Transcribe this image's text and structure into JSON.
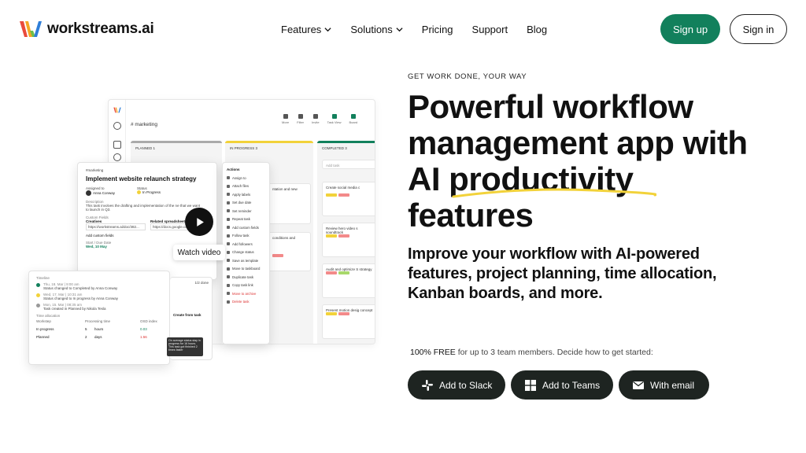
{
  "brand": {
    "name": "workstreams.ai"
  },
  "nav": {
    "items": [
      {
        "label": "Features",
        "dropdown": true
      },
      {
        "label": "Solutions",
        "dropdown": true
      },
      {
        "label": "Pricing",
        "dropdown": false
      },
      {
        "label": "Support",
        "dropdown": false
      },
      {
        "label": "Blog",
        "dropdown": false
      }
    ],
    "signup": "Sign up",
    "signin": "Sign in"
  },
  "hero": {
    "kicker": "GET WORK DONE, YOUR WAY",
    "title_lines": [
      "Powerful workflow",
      "management app with",
      "AI productivity",
      "features"
    ],
    "subtitle_lines": [
      "Improve your workflow with AI-powered",
      "features, project planning, time allocation,",
      "Kanban boards, and more."
    ],
    "free_bold": "100% FREE",
    "free_rest": " for up to 3 team members.  Decide how to get started:",
    "cta_slack": "Add to Slack",
    "cta_teams": "Add to Teams",
    "cta_email": "With email"
  },
  "mockup": {
    "channel": "# marketing",
    "toolbar": [
      "More",
      "Filter",
      "Invite",
      "Task View",
      "Board"
    ],
    "columns": [
      {
        "title": "PLANNED",
        "count": "1"
      },
      {
        "title": "IN PROGRESS",
        "count": "3"
      },
      {
        "title": "COMPLETED",
        "count": "3"
      }
    ],
    "add_task": "Add task",
    "completed_cards": [
      "Create social media c",
      "Review hero video s soundtrack",
      "Audit and optimize S strategy",
      "Present motion desig concept"
    ],
    "inprogress_cards": [
      "ntation and new",
      "conditions and"
    ],
    "task_panel": {
      "channel": "#marketing",
      "title": "Implement website relaunch strategy",
      "assigned_label": "Assigned to",
      "assigned_value": "Anna Conway",
      "status_label": "Status",
      "status_value": "In Progress",
      "description_label": "Description",
      "description": "This task involves the drafting and implementation of the ne that we want to launch in Q3.",
      "custom_fields_label": "Custom Fields",
      "creatives_label": "Creatives",
      "creatives_value": "https://workstreams.ai/doc/382...",
      "spreadsheet_label": "Related spreadsheet",
      "spreadsheet_value": "https://docs.google.com/spread...",
      "add_custom": "Add custom fields",
      "dates_label": "Start / Due Date",
      "dates_value": "Wed, 10 May"
    },
    "actions_panel": {
      "title": "Actions",
      "items": [
        "Assign to",
        "Attach files",
        "Apply labels",
        "Set due date",
        "Set reminder",
        "Repeat task",
        "Add custom fields",
        "Follow task",
        "Add followers",
        "Change status",
        "Save as template",
        "Move to taskboard",
        "Duplicate task",
        "Copy task link",
        "Move to archive",
        "Delete task"
      ]
    },
    "timeline_panel": {
      "title": "Timeline",
      "progress": "1/2 done",
      "entries": [
        {
          "date": "Thu, 18. Mar | 9:00 am",
          "text": "Status changed to Completed by Anna Conway"
        },
        {
          "date": "Wed, 17. Mar | 10:31 am",
          "text": "Status changed to In progress by Anna Conway"
        },
        {
          "date": "Mon, 15. Mar | 08:35 am",
          "text": "Task created in Planned by Nikola Tesla"
        }
      ],
      "time_alloc_label": "Time allocation",
      "headers": [
        "Workstep",
        "Processing time",
        "OSD index"
      ],
      "rows": [
        {
          "step": "In progress",
          "time": "5",
          "unit": "hours",
          "index": "0.03"
        },
        {
          "step": "Planned",
          "time": "2",
          "unit": "days",
          "index": "1.56"
        }
      ],
      "create_from_task": "Create from task",
      "tooltip": "On average status stay in progress for 16 hours. This task got finished 2 times faster"
    },
    "watch_video": "Watch video"
  },
  "colors": {
    "accent": "#12805c",
    "dark": "#1e2421",
    "highlight": "#f2d23a"
  }
}
